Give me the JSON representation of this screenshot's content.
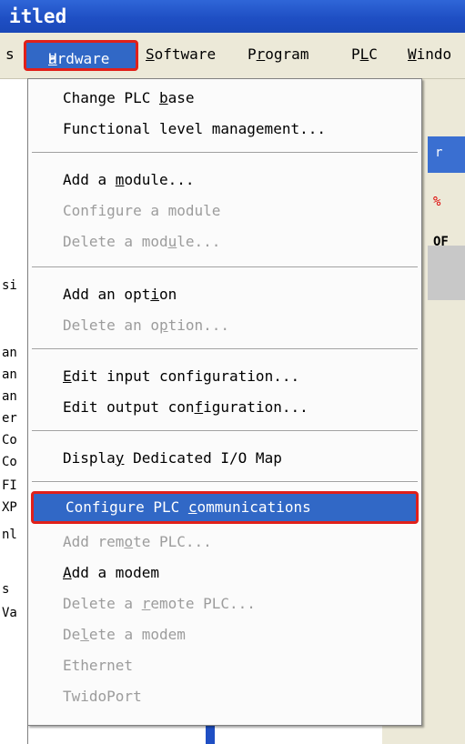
{
  "window": {
    "title": "itled"
  },
  "menubar": {
    "items": [
      {
        "key": "s",
        "label": "s"
      },
      {
        "key": "hardware",
        "label_html": true,
        "prefix": "",
        "ul": "H",
        "rest": "ardware"
      },
      {
        "key": "software",
        "ul": "S",
        "rest": "oftware"
      },
      {
        "key": "program",
        "pre": "P",
        "ul": "r",
        "rest": "ogram"
      },
      {
        "key": "plc",
        "pre": "P",
        "ul": "L",
        "rest": "C"
      },
      {
        "key": "window",
        "ul": "W",
        "rest": "indo"
      }
    ]
  },
  "background": {
    "left_fragments": [
      "si",
      "an",
      "an",
      "an",
      "er",
      "Co",
      "Co",
      "FI",
      "XP",
      "nl",
      "s",
      "Va"
    ],
    "right_fragments": [
      "r",
      "%",
      "OF"
    ]
  },
  "dropdown": {
    "items": [
      {
        "type": "item",
        "pre": "Change PLC ",
        "ul": "b",
        "post": "ase",
        "enabled": true
      },
      {
        "type": "item",
        "pre": "Functional level management...",
        "ul": "",
        "post": "",
        "enabled": true
      },
      {
        "type": "sep"
      },
      {
        "type": "item",
        "pre": "Add a ",
        "ul": "m",
        "post": "odule...",
        "enabled": true
      },
      {
        "type": "item",
        "pre": "Configure a module",
        "ul": "",
        "post": "",
        "enabled": false
      },
      {
        "type": "item",
        "pre": "Delete a mod",
        "ul": "u",
        "post": "le...",
        "enabled": false
      },
      {
        "type": "sep"
      },
      {
        "type": "item",
        "pre": "Add an opt",
        "ul": "i",
        "post": "on",
        "enabled": true
      },
      {
        "type": "item",
        "pre": "Delete an o",
        "ul": "p",
        "post": "tion...",
        "enabled": false
      },
      {
        "type": "sep"
      },
      {
        "type": "item",
        "pre": "",
        "ul": "E",
        "post": "dit input configuration...",
        "enabled": true
      },
      {
        "type": "item",
        "pre": "Edit output con",
        "ul": "f",
        "post": "iguration...",
        "enabled": true
      },
      {
        "type": "sep"
      },
      {
        "type": "item",
        "pre": "Displa",
        "ul": "y",
        "post": " Dedicated I/O Map",
        "enabled": true
      },
      {
        "type": "sep"
      },
      {
        "type": "item",
        "pre": "Configure PLC ",
        "ul": "c",
        "post": "ommunications",
        "enabled": true,
        "highlight": true
      },
      {
        "type": "item",
        "pre": "Add rem",
        "ul": "o",
        "post": "te PLC...",
        "enabled": false
      },
      {
        "type": "item",
        "pre": "",
        "ul": "A",
        "post": "dd a modem",
        "enabled": true
      },
      {
        "type": "item",
        "pre": "Delete a ",
        "ul": "r",
        "post": "emote PLC...",
        "enabled": false
      },
      {
        "type": "item",
        "pre": "De",
        "ul": "l",
        "post": "ete a modem",
        "enabled": false
      },
      {
        "type": "item",
        "pre": "Ethernet",
        "ul": "",
        "post": "",
        "enabled": false
      },
      {
        "type": "item",
        "pre": "TwidoPort",
        "ul": "",
        "post": "",
        "enabled": false
      }
    ]
  },
  "colors": {
    "titlebar": "#2a5fd2",
    "menubar": "#ece9d8",
    "highlight": "#3168c6",
    "annotation_border": "#e0201a",
    "disabled_text": "#9c9c9c"
  }
}
